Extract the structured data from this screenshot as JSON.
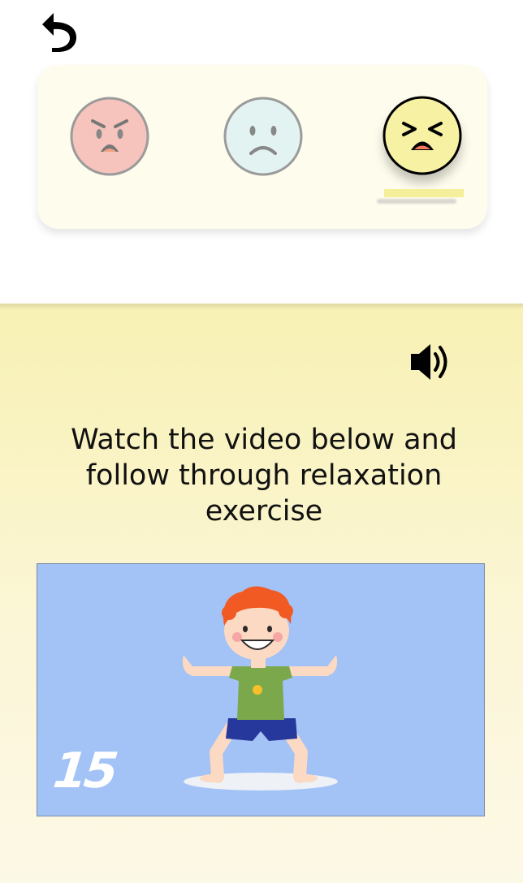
{
  "header": {
    "back_icon": "undo-arrow-icon"
  },
  "mood_selector": {
    "options": [
      {
        "mood": "angry",
        "icon": "angry-face-icon",
        "color": "#f6c3bd",
        "selected": false
      },
      {
        "mood": "sad",
        "icon": "sad-face-icon",
        "color": "#e3f3f2",
        "selected": false
      },
      {
        "mood": "stressed",
        "icon": "stressed-face-icon",
        "color": "#f6f1a3",
        "selected": true
      }
    ]
  },
  "exercise": {
    "audio_icon": "speaker-icon",
    "instruction": "Watch the video below and follow through relaxation exercise",
    "video": {
      "counter": "15",
      "background": "#a3c2f6"
    }
  }
}
